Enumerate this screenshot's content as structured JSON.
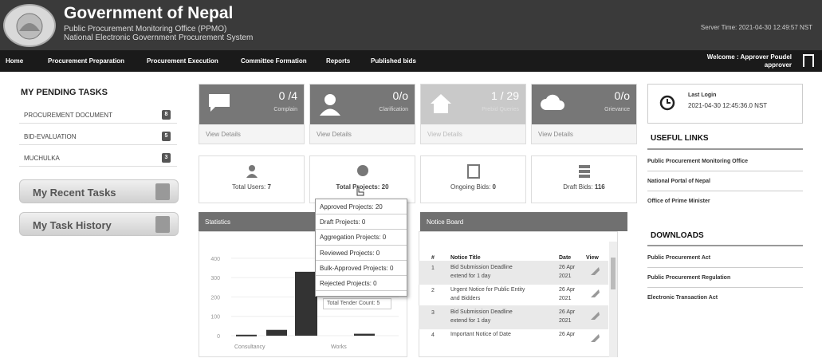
{
  "header": {
    "title": "Government of Nepal",
    "sub1": "Public Procurement Monitoring Office (PPMO)",
    "sub2": "National Electronic Government Procurement System",
    "server_time": "Server Time: 2021-04-30 12:49:57 NST"
  },
  "nav": {
    "items": [
      "Home",
      "Procurement Preparation",
      "Procurement Execution",
      "Committee Formation",
      "Reports",
      "Published bids"
    ],
    "welcome1": "Welcome : Approver Poudel",
    "welcome2": "approver"
  },
  "pending": {
    "title": "MY PENDING TASKS",
    "items": [
      {
        "label": "PROCUREMENT DOCUMENT",
        "count": "8"
      },
      {
        "label": "BID-EVALUATION",
        "count": "5"
      },
      {
        "label": "MUCHULKA",
        "count": "3"
      }
    ]
  },
  "recent": "My Recent Tasks",
  "history": "My Task History",
  "cards": [
    {
      "num": "0 /4",
      "sub": "Complain",
      "view": "View Details"
    },
    {
      "num": "0/o",
      "sub": "Clarification",
      "view": "View Details"
    },
    {
      "num": "1 / 29",
      "sub": "Prebid Queries",
      "view": "View Details"
    },
    {
      "num": "0/o",
      "sub": "Grievance",
      "view": "View Details"
    }
  ],
  "stats": [
    {
      "label": "Total Users: ",
      "val": "7"
    },
    {
      "label": "Total Projects: ",
      "val": "20"
    },
    {
      "label": "Ongoing Bids: ",
      "val": "0"
    },
    {
      "label": "Draft Bids: ",
      "val": "116"
    }
  ],
  "dropdown": [
    "Approved Projects: 20",
    "Draft Projects: 0",
    "Aggregation Projects: 0",
    "Reviewed Projects: 0",
    "Bulk-Approved Projects: 0",
    "Rejected Projects: 0"
  ],
  "statistics": {
    "title": "Statistics",
    "tooltip": "Total Tender Count: 5",
    "cats": [
      "Consultancy",
      "Works"
    ],
    "yticks": [
      "400",
      "300",
      "200",
      "100",
      "0"
    ]
  },
  "chart_data": {
    "type": "bar",
    "categories": [
      "Consultancy",
      "",
      "Works",
      ""
    ],
    "values": [
      5,
      30,
      330,
      10
    ],
    "ylim": [
      0,
      420
    ]
  },
  "notice": {
    "title": "Notice Board",
    "cols": [
      "#",
      "Notice Title",
      "Date",
      "View"
    ],
    "rows": [
      {
        "n": "1",
        "t1": "Bid Submission Deadline",
        "t2": "extend for 1 day",
        "d1": "26 Apr",
        "d2": "2021"
      },
      {
        "n": "2",
        "t1": "Urgent Notice for Public Entity",
        "t2": "and Bidders",
        "d1": "26 Apr",
        "d2": "2021"
      },
      {
        "n": "3",
        "t1": "Bid Submission Deadline",
        "t2": "extend for 1 day",
        "d1": "26 Apr",
        "d2": "2021"
      },
      {
        "n": "4",
        "t1": "Important Notice of Date",
        "t2": "",
        "d1": "26 Apr",
        "d2": ""
      }
    ]
  },
  "right": {
    "last_login": "Last Login",
    "login_time": "2021-04-30 12:45:36.0 NST",
    "useful_title": "USEFUL LINKS",
    "useful": [
      "Public Procurement Monitoring Office",
      "National Portal of Nepal",
      "Office of Prime Minister"
    ],
    "dl_title": "DOWNLOADS",
    "downloads": [
      "Public Procurement Act",
      "Public Procurement Regulation",
      "Electronic Transaction Act"
    ]
  }
}
